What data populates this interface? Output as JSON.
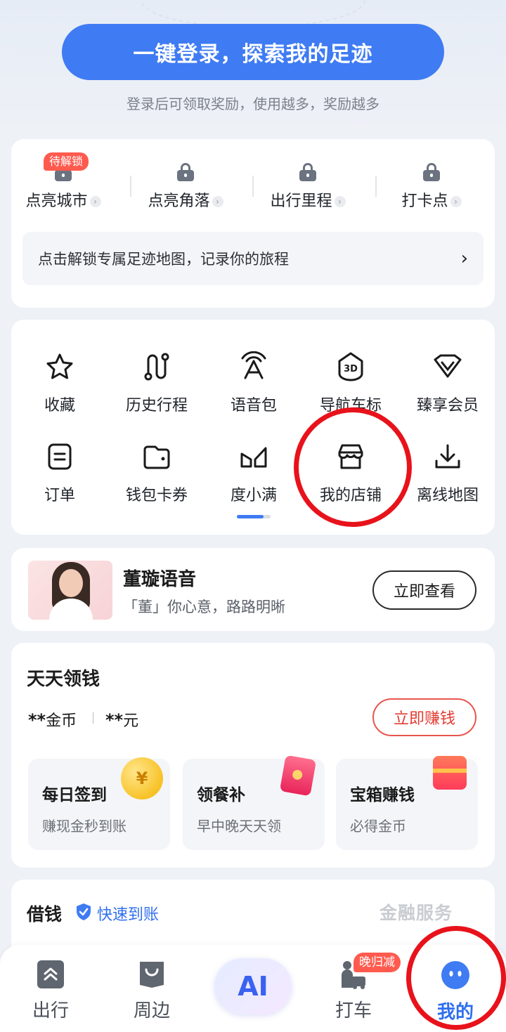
{
  "header": {
    "login_button": "一键登录，探索我的足迹",
    "login_subtitle": "登录后可领取奖励，使用越多，奖励越多"
  },
  "footprint": {
    "badge": "待解锁",
    "items": [
      {
        "label": "点亮城市"
      },
      {
        "label": "点亮角落"
      },
      {
        "label": "出行里程"
      },
      {
        "label": "打卡点"
      }
    ],
    "banner": "点击解锁专属足迹地图，记录你的旅程"
  },
  "grid": {
    "items": [
      {
        "label": "收藏",
        "icon": "star-icon"
      },
      {
        "label": "历史行程",
        "icon": "route-icon"
      },
      {
        "label": "语音包",
        "icon": "voice-icon"
      },
      {
        "label": "导航车标",
        "icon": "3d-icon"
      },
      {
        "label": "臻享会员",
        "icon": "vip-icon"
      },
      {
        "label": "订单",
        "icon": "order-icon"
      },
      {
        "label": "钱包卡券",
        "icon": "wallet-icon"
      },
      {
        "label": "度小满",
        "icon": "duxiaoman-icon"
      },
      {
        "label": "我的店铺",
        "icon": "shop-icon"
      },
      {
        "label": "离线地图",
        "icon": "download-icon"
      }
    ]
  },
  "voice": {
    "title": "董璇语音",
    "subtitle": "「董」你心意，路路明晰",
    "button": "立即查看"
  },
  "earn": {
    "title": "天天领钱",
    "coins_stars": "**",
    "coins_unit": "金币",
    "yuan_stars": "**",
    "yuan_unit": "元",
    "button": "立即赚钱",
    "tasks": [
      {
        "title": "每日签到",
        "sub": "赚现金秒到账"
      },
      {
        "title": "领餐补",
        "sub": "早中晚天天领"
      },
      {
        "title": "宝箱赚钱",
        "sub": "必得金币"
      }
    ],
    "coin_symbol": "¥"
  },
  "borrow": {
    "title": "借钱",
    "fast": "快速到账",
    "service": "金融服务"
  },
  "nav": {
    "items": [
      {
        "label": "出行"
      },
      {
        "label": "周边"
      },
      {
        "label": "AI"
      },
      {
        "label": "打车"
      },
      {
        "label": "我的"
      }
    ],
    "late_badge": "晚归减"
  },
  "colors": {
    "accent": "#3f7bf3",
    "alert": "#e8121b"
  }
}
